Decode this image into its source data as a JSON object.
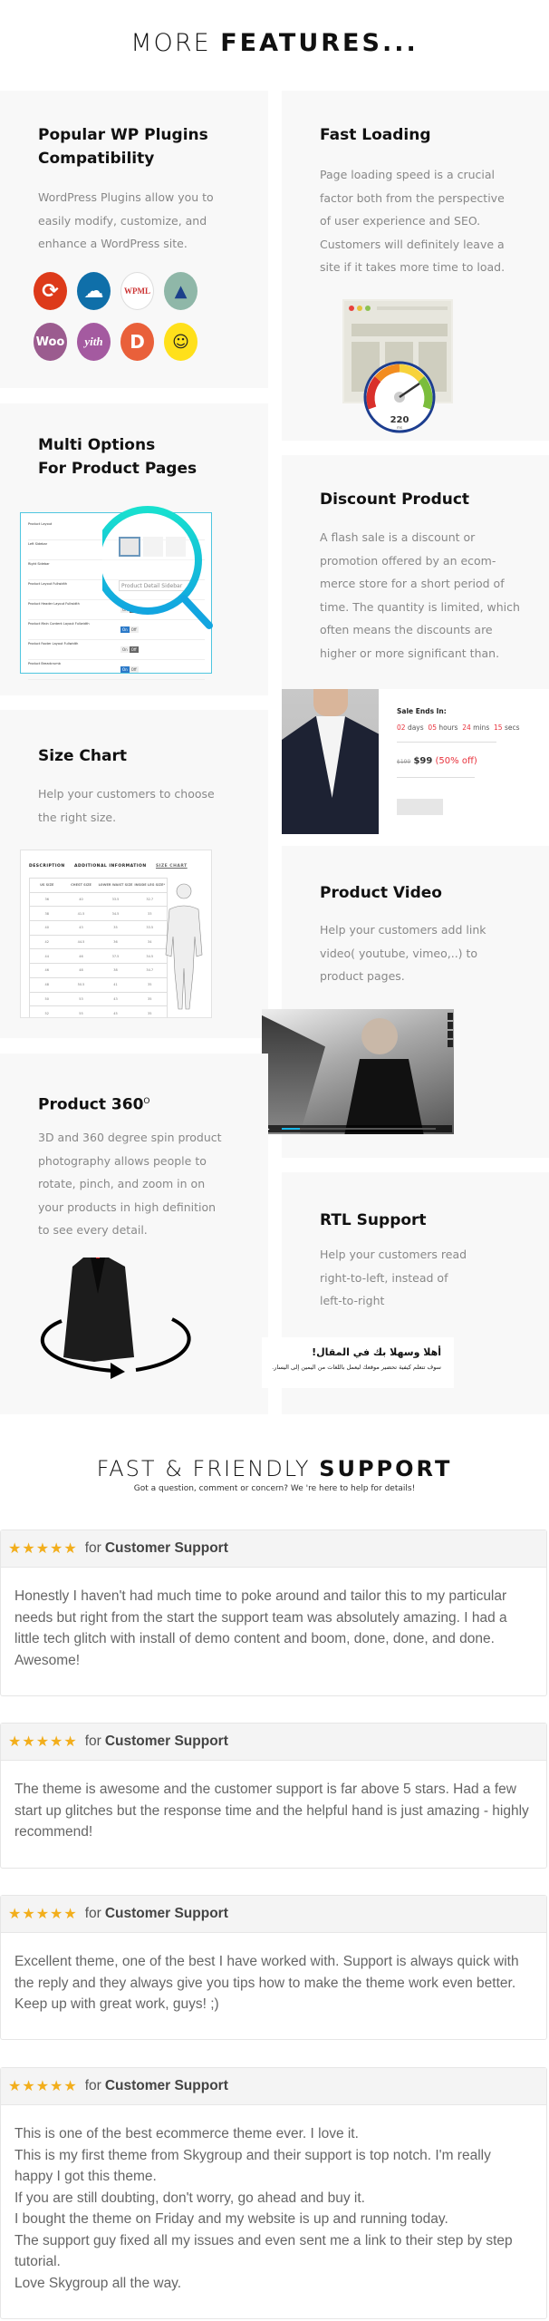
{
  "features_heading": {
    "light": "MORE",
    "bold": "FEATURES..."
  },
  "features": [
    {
      "title_lines": [
        "Popular WP Plugins",
        "Compatibility"
      ],
      "text_lines": [
        "WordPress Plugins allow you to",
        "easily modify, customize, and",
        "enhance a WordPress site."
      ],
      "plugins": [
        {
          "icon": "sync-icon",
          "label": "",
          "color": "#dd3a1a"
        },
        {
          "icon": "cloud-icon",
          "label": "",
          "color": "#0f6fa9"
        },
        {
          "icon": "wpml-icon",
          "label": "WPML",
          "color": "#ffffff"
        },
        {
          "icon": "mountain-icon",
          "label": "",
          "color": "#8fb7a8"
        },
        {
          "icon": "woo-icon",
          "label": "Woo",
          "color": "#9b5c8f"
        },
        {
          "icon": "yith-icon",
          "label": "yith",
          "color": "#a45aa0"
        },
        {
          "icon": "d-icon",
          "label": "D",
          "color": "#e9603a"
        },
        {
          "icon": "mailchimp-icon",
          "label": "",
          "color": "#ffe01b"
        }
      ]
    },
    {
      "title_lines": [
        "Fast Loading"
      ],
      "text_lines": [
        "Page loading speed is a crucial",
        "factor both from the perspective",
        "of user experience and SEO.",
        "Customers will definitely leave a",
        "site if it takes more time to load."
      ],
      "gauge_value": "220",
      "gauge_unit": "ms"
    },
    {
      "title_lines": [
        "Multi Options",
        "For Product Pages"
      ],
      "options": [
        "Product Layout",
        "Left Sidebar",
        "Right Sidebar",
        "Product Layout Fullwidth",
        "Product Header Layout Fullwidth",
        "Product Main Content Layout Fullwidth",
        "Product Footer Layout Fullwidth",
        "Product Breadcrumb"
      ],
      "select_value": "Product Detail Sidebar",
      "on": "On",
      "off": "Off"
    },
    {
      "title_lines": [
        "Discount Product"
      ],
      "text_lines": [
        "A flash sale is a discount or",
        "promotion offered by an ecom-",
        "merce store for a short period of",
        "time. The quantity is limited, which",
        "often means  the discounts are",
        "higher or more significant than."
      ],
      "sale": {
        "label": "Sale Ends In:",
        "days": "02",
        "days_u": "days",
        "hours": "05",
        "hours_u": "hours",
        "mins": "24",
        "mins_u": "mins",
        "secs": "15",
        "secs_u": "secs",
        "old_price": "$199",
        "price": "$99",
        "off": "(50% off)"
      }
    },
    {
      "title_lines": [
        "Size Chart"
      ],
      "text_lines": [
        "Help your customers to choose",
        "the right size."
      ],
      "size_chart": {
        "tabs": [
          "DESCRIPTION",
          "ADDITIONAL INFORMATION",
          "SIZE CHART"
        ],
        "headers": [
          "US SIZE",
          "CHEST SIZE",
          "LOWER WAIST SIZE",
          "INSIDE LEG SIZE*"
        ],
        "rows": [
          [
            "36",
            "40",
            "33.5",
            "32.7"
          ],
          [
            "38",
            "41.5",
            "34.5",
            "33"
          ],
          [
            "40",
            "43",
            "35",
            "33.5"
          ],
          [
            "42",
            "44.5",
            "36",
            "34"
          ],
          [
            "44",
            "46",
            "37.5",
            "34.5"
          ],
          [
            "46",
            "48",
            "38",
            "34.7"
          ],
          [
            "48",
            "50.5",
            "41",
            "35"
          ],
          [
            "50",
            "53",
            "43",
            "35"
          ],
          [
            "52",
            "55",
            "45",
            "35"
          ]
        ]
      }
    },
    {
      "title_lines": [
        "Product Video"
      ],
      "text_lines": [
        "Help your customers add link",
        "video( youtube, vimeo,..)  to",
        "product pages."
      ],
      "video_progress": 0.12
    },
    {
      "title_lines": [
        "Product 360"
      ],
      "title_sup": "O",
      "text_lines": [
        "3D and 360 degree spin product",
        "photography allows people to",
        "rotate, pinch, and zoom in on",
        "your products in high definition",
        "to see every detail."
      ]
    },
    {
      "title_lines": [
        "RTL Support"
      ],
      "text_lines": [
        "Help your customers read",
        "right-to-left, instead of",
        "left-to-right"
      ],
      "rtl_heading": "أهلا وسهلا بك في المقال!",
      "rtl_text": "سوف تتعلم كيفية تحضير موقعك ليعمل باللغات من اليمين إلى اليسار."
    }
  ],
  "support": {
    "light": "FAST & FRIENDLY",
    "bold": "SUPPORT",
    "subtitle": "Got a question, comment or concern? We 're here to help for details!"
  },
  "reviews": [
    {
      "stars": "★★★★★",
      "for": "for",
      "category": "Customer Support",
      "lines": [
        "Honestly I haven't had much time to poke around and tailor this to my particular needs but right from the start the support team was absolutely amazing. I had a little tech glitch with install of demo content and boom, done, done, and done. Awesome!"
      ]
    },
    {
      "stars": "★★★★★",
      "for": "for",
      "category": "Customer Support",
      "lines": [
        "The theme is awesome and the customer support is far above 5 stars. Had a few start up glitches but the response time and the helpful hand is just amazing - highly recommend!"
      ]
    },
    {
      "stars": "★★★★★",
      "for": "for",
      "category": "Customer Support",
      "lines": [
        "Excellent theme, one of the best I have worked with. Support is always quick with the reply and they always give you tips how to make the theme work even better. Keep up with great work, guys! ;)"
      ]
    },
    {
      "stars": "★★★★★",
      "for": "for",
      "category": "Customer Support",
      "lines": [
        "This is one of the best ecommerce theme ever. I love it.",
        "This is my first theme from Skygroup and their support is top notch. I'm really happy I got this theme.",
        "If you are still doubting, don't worry, go ahead and buy it.",
        "I bought the theme on Friday and my website is up and running today.",
        "The support guy fixed all my issues and even sent me a link to their step by step tutorial.",
        "Love Skygroup all the way."
      ]
    }
  ],
  "colors": {
    "star": "#f2ae1c",
    "accent_cyan": "#16d3d0",
    "sale_red": "#e8313b"
  }
}
